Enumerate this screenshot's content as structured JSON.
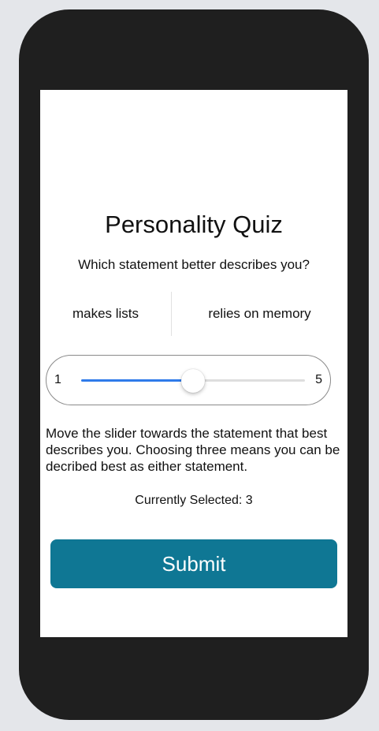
{
  "quiz": {
    "title": "Personality Quiz",
    "question": "Which statement better describes you?",
    "option_left": "makes lists",
    "option_right": "relies on memory"
  },
  "slider": {
    "min_label": "1",
    "max_label": "5",
    "min": 1,
    "max": 5,
    "value": 3,
    "accent_color": "#2f7bea"
  },
  "description": "Move the slider towards the statement that best describes you. Choosing three means you can be decribed best as either statement.",
  "current_selection": "Currently Selected: 3",
  "submit": {
    "label": "Submit",
    "color": "#0f7794"
  }
}
